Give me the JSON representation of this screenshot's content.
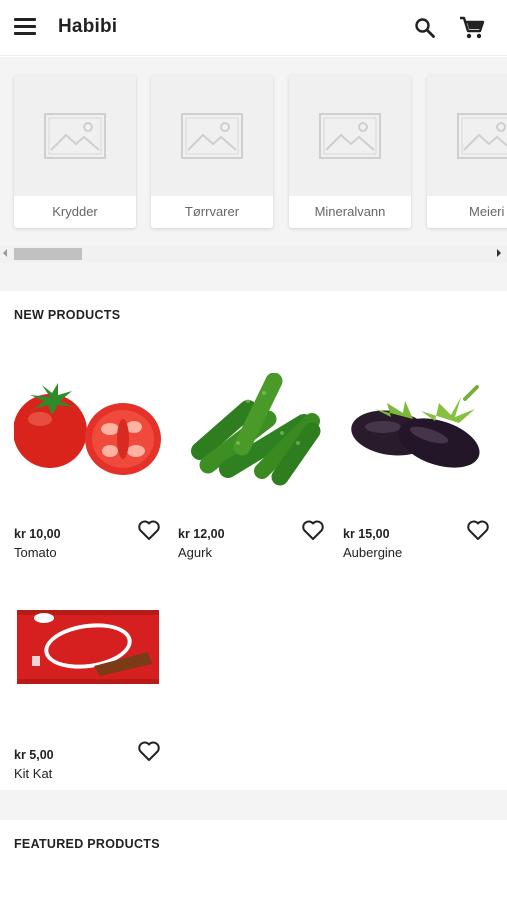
{
  "app": {
    "title": "Habibi"
  },
  "header": {
    "menu_icon": "menu-icon",
    "search_icon": "search-icon",
    "cart_icon": "cart-icon"
  },
  "categories": [
    {
      "label": "Krydder"
    },
    {
      "label": "Tørrvarer"
    },
    {
      "label": "Mineralvann"
    },
    {
      "label": "Meieri"
    }
  ],
  "sections": {
    "new_products": "NEW PRODUCTS",
    "featured_products": "FEATURED PRODUCTS"
  },
  "products": [
    {
      "price": "kr 10,00",
      "name": "Tomato"
    },
    {
      "price": "kr 12,00",
      "name": "Agurk"
    },
    {
      "price": "kr 15,00",
      "name": "Aubergine"
    },
    {
      "price": "kr 5,00",
      "name": "Kit Kat"
    }
  ],
  "colors": {
    "accent": "#222222",
    "kitkat_red": "#d6201f",
    "background_gray": "#f4f4f4"
  }
}
